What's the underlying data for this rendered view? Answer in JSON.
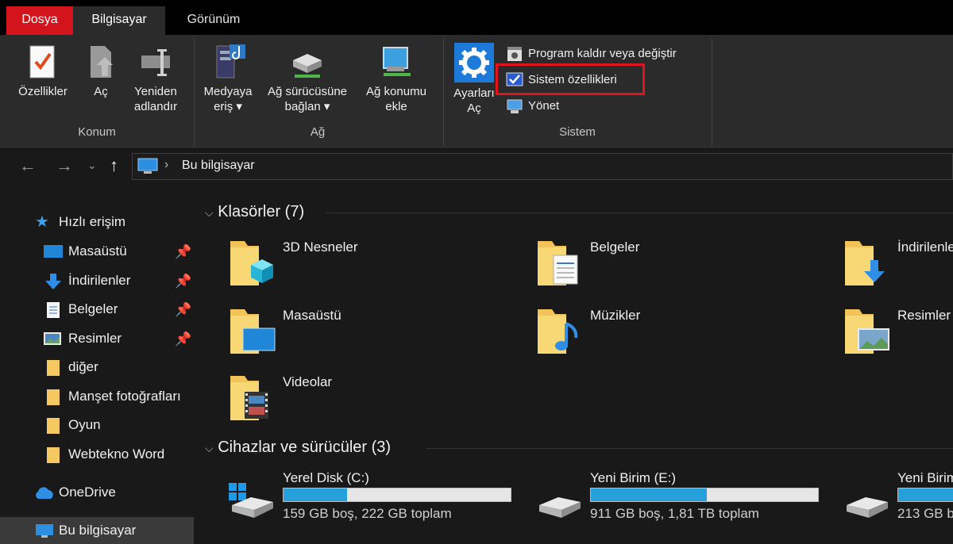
{
  "tabs": {
    "file": "Dosya",
    "computer": "Bilgisayar",
    "view": "Görünüm"
  },
  "ribbon": {
    "konum": {
      "label": "Konum",
      "properties": "Özellikler",
      "open": "Aç",
      "rename_line1": "Yeniden",
      "rename_line2": "adlandır"
    },
    "ag": {
      "label": "Ağ",
      "media_line1": "Medyaya",
      "media_line2": "eriş",
      "map_line1": "Ağ sürücüsüne",
      "map_line2": "bağlan",
      "add_line1": "Ağ konumu",
      "add_line2": "ekle"
    },
    "sistem": {
      "label": "Sistem",
      "settings_line1": "Ayarları",
      "settings_line2": "Aç",
      "uninstall": "Program kaldır veya değiştir",
      "system_props": "Sistem özellikleri",
      "manage": "Yönet"
    }
  },
  "address": {
    "path": "Bu bilgisayar",
    "separator": "›"
  },
  "sidebar": {
    "quick_access": "Hızlı erişim",
    "items": [
      {
        "label": "Masaüstü",
        "pinned": true
      },
      {
        "label": "İndirilenler",
        "pinned": true
      },
      {
        "label": "Belgeler",
        "pinned": true
      },
      {
        "label": "Resimler",
        "pinned": true
      },
      {
        "label": "diğer"
      },
      {
        "label": "Manşet fotoğrafları"
      },
      {
        "label": "Oyun"
      },
      {
        "label": "Webtekno Word"
      }
    ],
    "onedrive": "OneDrive",
    "this_pc": "Bu bilgisayar"
  },
  "main": {
    "folders_header": "Klasörler (7)",
    "folders": [
      "3D Nesneler",
      "Belgeler",
      "İndirilenler",
      "Masaüstü",
      "Müzikler",
      "Resimler",
      "Videolar"
    ],
    "drives_header": "Cihazlar ve sürücüler (3)",
    "drives": [
      {
        "name": "Yerel Disk (C:)",
        "info": "159 GB boş, 222 GB toplam",
        "used_fraction": 0.28
      },
      {
        "name": "Yeni Birim (E:)",
        "info": "911 GB boş, 1,81 TB toplam",
        "used_fraction": 0.51
      },
      {
        "name": "Yeni Birim",
        "info": "213 GB b",
        "used_fraction": 0.3
      }
    ]
  },
  "colors": {
    "accent": "#26a0da",
    "file_tab": "#d4141c",
    "highlight": "#e0141c"
  }
}
